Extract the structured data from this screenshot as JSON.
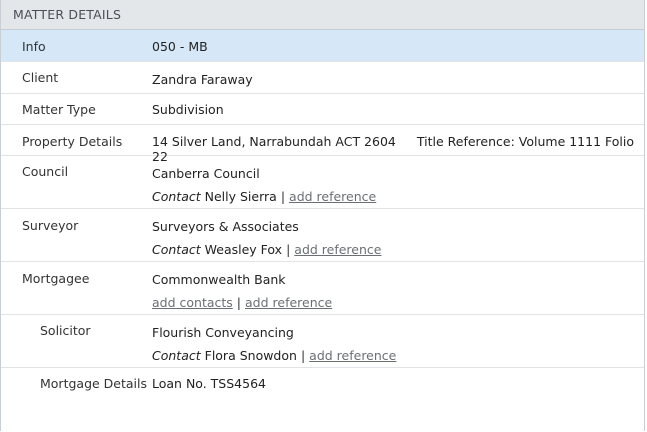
{
  "header": {
    "title": "MATTER DETAILS"
  },
  "info": {
    "label": "Info",
    "value": "050 - MB"
  },
  "client": {
    "label": "Client",
    "value": "Zandra Faraway"
  },
  "matter_type": {
    "label": "Matter Type",
    "value": "Subdivision"
  },
  "property": {
    "label": "Property Details",
    "address": "14 Silver Land, Narrabundah ACT 2604",
    "title_reference": "Title Reference: Volume 1111 Folio 22"
  },
  "council": {
    "label": "Council",
    "name": "Canberra Council",
    "contact_prefix": "Contact",
    "contact_name": "Nelly Sierra",
    "separator": "|",
    "add_reference": "add reference"
  },
  "surveyor": {
    "label": "Surveyor",
    "name": "Surveyors & Associates",
    "contact_prefix": "Contact",
    "contact_name": "Weasley Fox",
    "separator": "|",
    "add_reference": "add reference"
  },
  "mortgagee": {
    "label": "Mortgagee",
    "name": "Commonwealth Bank",
    "add_contacts": "add contacts",
    "separator": "|",
    "add_reference": "add reference"
  },
  "solicitor": {
    "label": "Solicitor",
    "name": "Flourish Conveyancing",
    "contact_prefix": "Contact",
    "contact_name": "Flora Snowdon",
    "separator": "|",
    "add_reference": "add reference"
  },
  "mortgage_details": {
    "label": "Mortgage Details",
    "value": "Loan No. TSS4564"
  },
  "colors": {
    "selected_row_bg": "#d6e8f7",
    "header_bg": "#e3e7ea",
    "link": "#6b6f75"
  }
}
